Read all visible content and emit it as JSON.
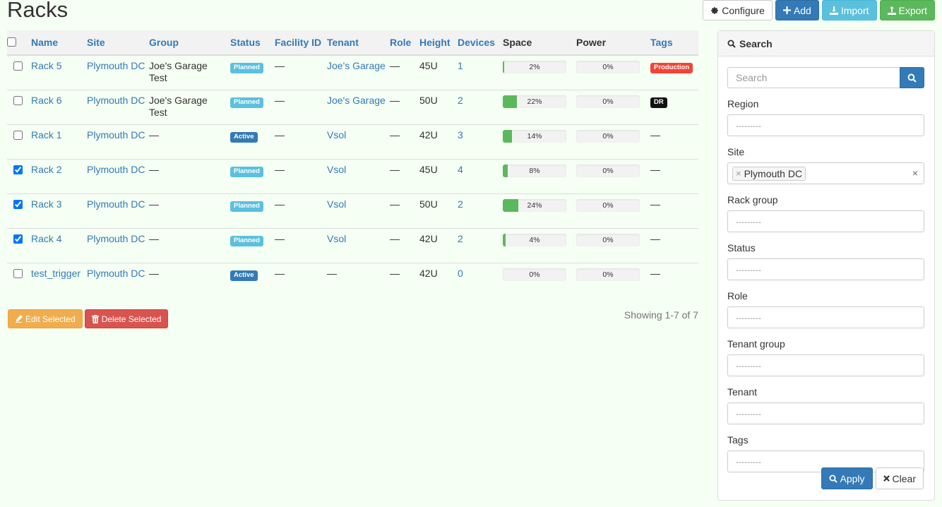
{
  "page": {
    "title": "Racks"
  },
  "toolbar": {
    "configure": "Configure",
    "add": "Add",
    "import": "Import",
    "export": "Export"
  },
  "table": {
    "headers": {
      "name": "Name",
      "site": "Site",
      "group": "Group",
      "status": "Status",
      "facility_id": "Facility ID",
      "tenant": "Tenant",
      "role": "Role",
      "height": "Height",
      "devices": "Devices",
      "space": "Space",
      "power": "Power",
      "tags": "Tags"
    },
    "rows": [
      {
        "checked": false,
        "name": "Rack 5",
        "site": "Plymouth DC",
        "group": "Joe's Garage Test",
        "group_link": false,
        "status": "Planned",
        "facility_id": "—",
        "tenant": "Joe's Garage",
        "tenant_link": true,
        "role": "—",
        "height": "45U",
        "devices": "1",
        "space": 2,
        "space_label": "2%",
        "power": 0,
        "power_label": "0%",
        "tag": "Production",
        "tag_color": "#f44336"
      },
      {
        "checked": false,
        "name": "Rack 6",
        "site": "Plymouth DC",
        "group": "Joe's Garage Test",
        "group_link": false,
        "status": "Planned",
        "facility_id": "—",
        "tenant": "Joe's Garage",
        "tenant_link": true,
        "role": "—",
        "height": "50U",
        "devices": "2",
        "space": 22,
        "space_label": "22%",
        "power": 0,
        "power_label": "0%",
        "tag": "DR",
        "tag_color": "#111111"
      },
      {
        "checked": false,
        "name": "Rack 1",
        "site": "Plymouth DC",
        "group": "—",
        "group_link": false,
        "status": "Active",
        "facility_id": "—",
        "tenant": "Vsol",
        "tenant_link": true,
        "role": "—",
        "height": "42U",
        "devices": "3",
        "space": 14,
        "space_label": "14%",
        "power": 0,
        "power_label": "0%",
        "tag": "—",
        "tag_color": ""
      },
      {
        "checked": true,
        "name": "Rack 2",
        "site": "Plymouth DC",
        "group": "—",
        "group_link": false,
        "status": "Planned",
        "facility_id": "—",
        "tenant": "Vsol",
        "tenant_link": true,
        "role": "—",
        "height": "45U",
        "devices": "4",
        "space": 8,
        "space_label": "8%",
        "power": 0,
        "power_label": "0%",
        "tag": "—",
        "tag_color": ""
      },
      {
        "checked": true,
        "name": "Rack 3",
        "site": "Plymouth DC",
        "group": "—",
        "group_link": false,
        "status": "Planned",
        "facility_id": "—",
        "tenant": "Vsol",
        "tenant_link": true,
        "role": "—",
        "height": "50U",
        "devices": "2",
        "space": 24,
        "space_label": "24%",
        "power": 0,
        "power_label": "0%",
        "tag": "—",
        "tag_color": ""
      },
      {
        "checked": true,
        "name": "Rack 4",
        "site": "Plymouth DC",
        "group": "—",
        "group_link": false,
        "status": "Planned",
        "facility_id": "—",
        "tenant": "Vsol",
        "tenant_link": true,
        "role": "—",
        "height": "42U",
        "devices": "2",
        "space": 4,
        "space_label": "4%",
        "power": 0,
        "power_label": "0%",
        "tag": "—",
        "tag_color": ""
      },
      {
        "checked": false,
        "name": "test_trigger",
        "site": "Plymouth DC",
        "group": "—",
        "group_link": false,
        "status": "Active",
        "facility_id": "—",
        "tenant": "—",
        "tenant_link": false,
        "role": "—",
        "height": "42U",
        "devices": "0",
        "space": 0,
        "space_label": "0%",
        "power": 0,
        "power_label": "0%",
        "tag": "—",
        "tag_color": ""
      }
    ]
  },
  "status_colors": {
    "Planned": "#5bc0de",
    "Active": "#337ab7"
  },
  "bulk": {
    "edit": "Edit Selected",
    "delete": "Delete Selected"
  },
  "pagination": {
    "showing": "Showing 1-7 of 7"
  },
  "search": {
    "title": "Search",
    "input_placeholder": "Search",
    "fields": [
      {
        "key": "region",
        "label": "Region",
        "value": "---------",
        "chip": ""
      },
      {
        "key": "site",
        "label": "Site",
        "value": "",
        "chip": "Plymouth DC"
      },
      {
        "key": "rack-group",
        "label": "Rack group",
        "value": "---------",
        "chip": ""
      },
      {
        "key": "status",
        "label": "Status",
        "value": "---------",
        "chip": ""
      },
      {
        "key": "role",
        "label": "Role",
        "value": "---------",
        "chip": ""
      },
      {
        "key": "tenant-group",
        "label": "Tenant group",
        "value": "---------",
        "chip": ""
      },
      {
        "key": "tenant",
        "label": "Tenant",
        "value": "---------",
        "chip": ""
      },
      {
        "key": "tags",
        "label": "Tags",
        "value": "---------",
        "chip": ""
      }
    ],
    "apply": "Apply",
    "clear": "Clear"
  }
}
